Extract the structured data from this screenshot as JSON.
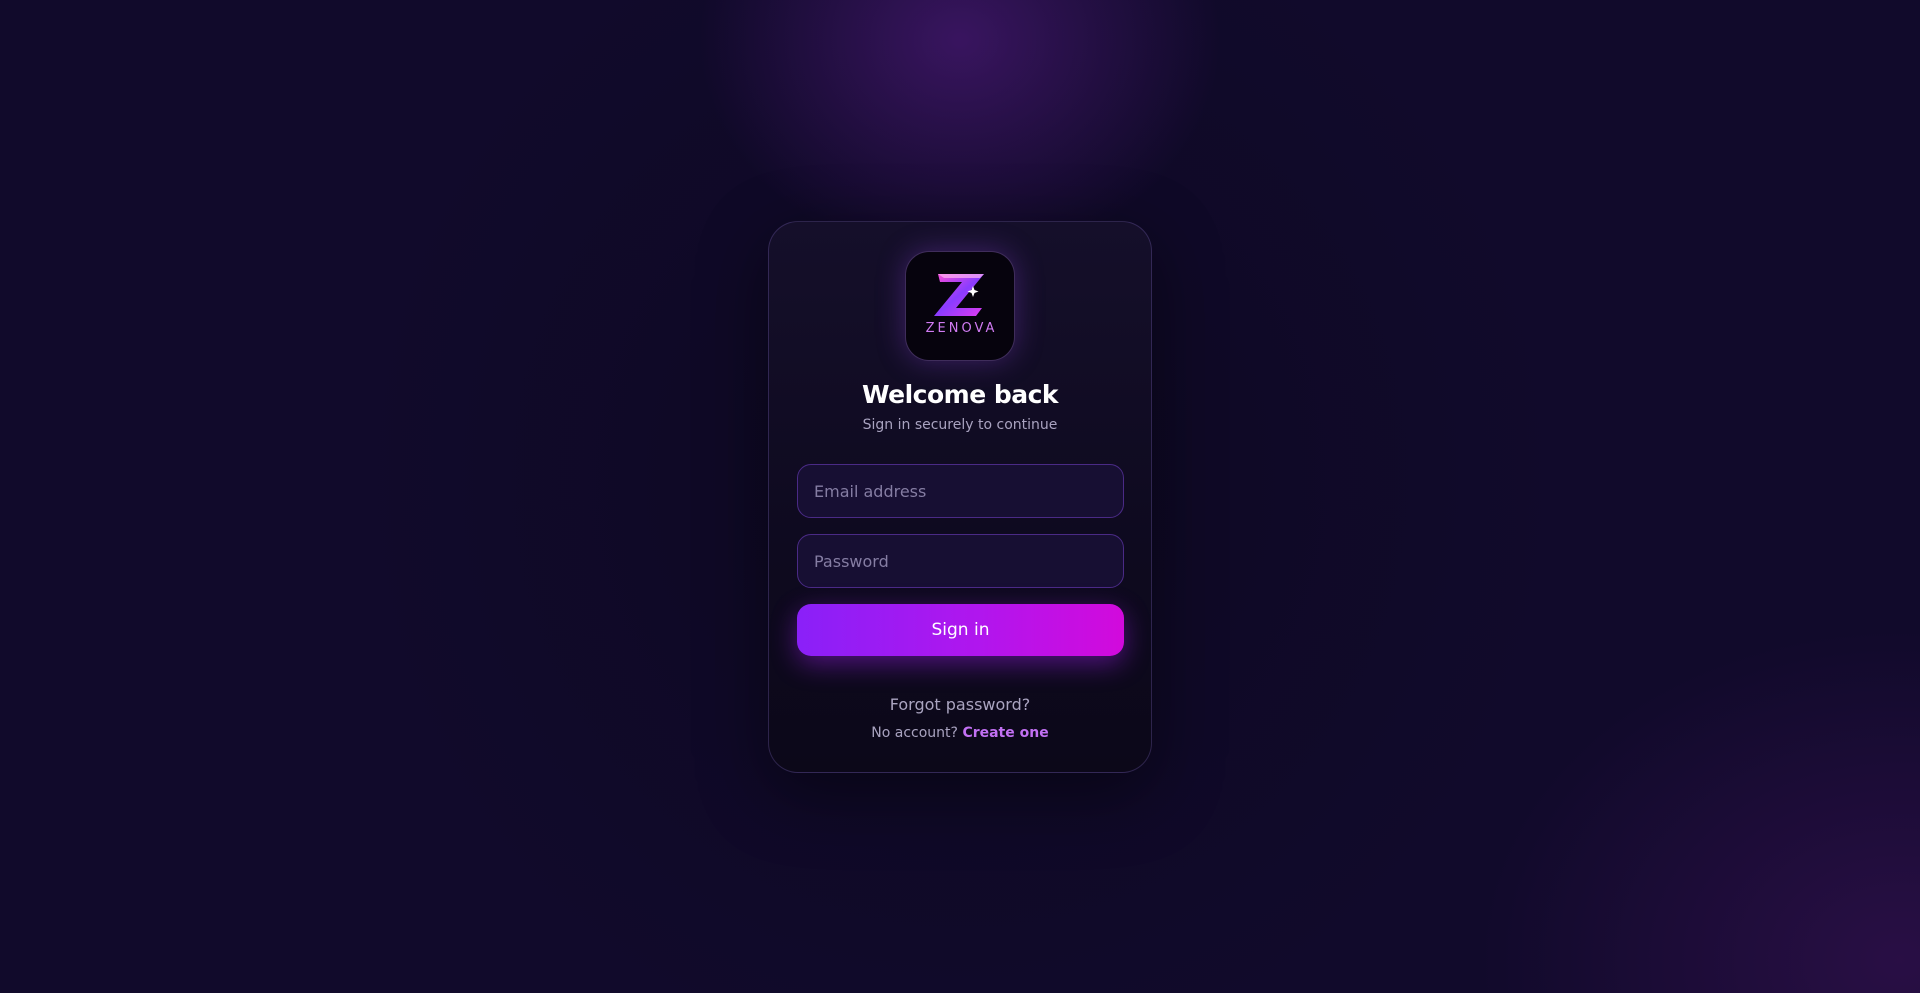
{
  "logo": {
    "icon": "zenova-z-logo-icon",
    "wordmark": "ZENOVA"
  },
  "auth": {
    "title": "Welcome back",
    "subtitle": "Sign in securely to continue",
    "email_placeholder": "Email address",
    "email_value": "",
    "password_placeholder": "Password",
    "password_value": "",
    "signin_label": "Sign in",
    "forgot_label": "Forgot password?",
    "no_account_text": "No account?",
    "create_label": "Create one"
  },
  "colors": {
    "background": "#120a2b",
    "card": "#110c24",
    "accent_start": "#8a20f8",
    "accent_end": "#d20adc",
    "link": "#c270f3"
  }
}
